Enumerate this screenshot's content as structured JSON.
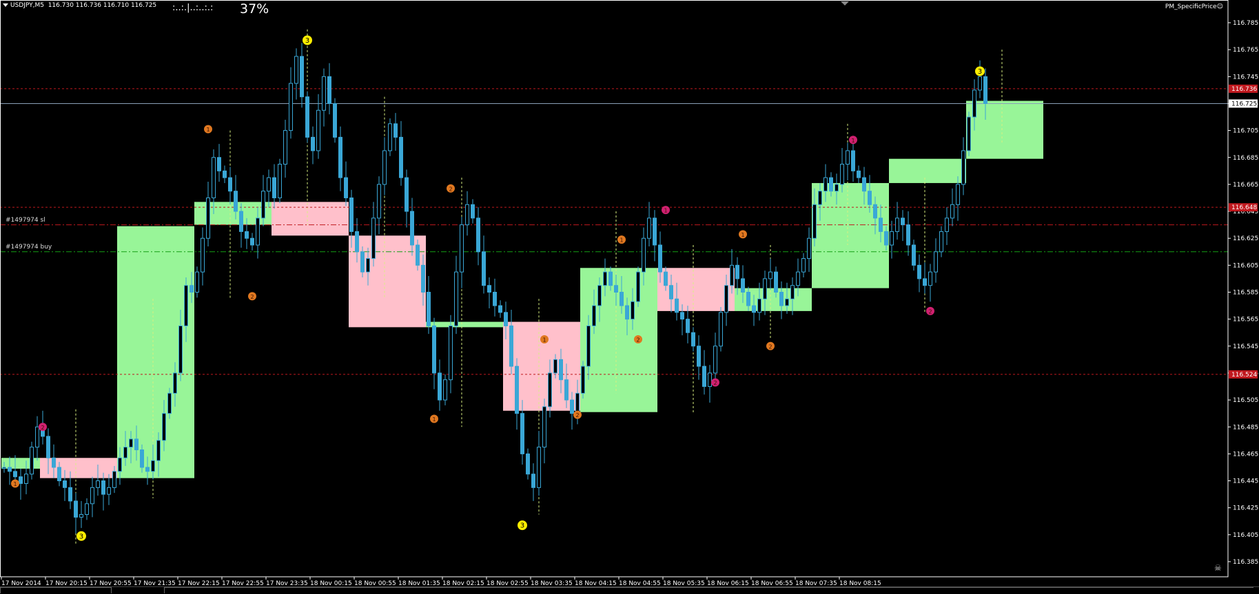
{
  "header": {
    "symbol": "USDJPY,M5",
    "ohlc": "116.730 116.736 116.710 116.725"
  },
  "progress": {
    "dots": ":..:.|..:..:.:",
    "percent_label": "37%",
    "percent_value": 37
  },
  "indicator_name": "PM_SpecificPrice",
  "orders": [
    {
      "label": "#1497974 sl",
      "price": 116.635,
      "color": "#c0181e"
    },
    {
      "label": "#1497974 buy",
      "price": 116.615,
      "color": "#14a014"
    }
  ],
  "price_axis": {
    "ticks": [
      "116.785",
      "116.765",
      "116.745",
      "116.725",
      "116.705",
      "116.685",
      "116.665",
      "116.645",
      "116.625",
      "116.605",
      "116.585",
      "116.565",
      "116.545",
      "116.525",
      "116.505",
      "116.485",
      "116.465",
      "116.445",
      "116.425",
      "116.405",
      "116.385"
    ],
    "current_price": "116.725",
    "marked_prices": [
      {
        "label": "116.736",
        "color": "#c0181e"
      },
      {
        "label": "116.648",
        "color": "#c0181e"
      },
      {
        "label": "116.524",
        "color": "#c0181e"
      }
    ]
  },
  "time_axis": {
    "labels": [
      "17 Nov 2014",
      "17 Nov 20:15",
      "17 Nov 20:55",
      "17 Nov 21:35",
      "17 Nov 22:15",
      "17 Nov 22:55",
      "17 Nov 23:35",
      "18 Nov 00:15",
      "18 Nov 00:55",
      "18 Nov 01:35",
      "18 Nov 02:15",
      "18 Nov 02:55",
      "18 Nov 03:35",
      "18 Nov 04:15",
      "18 Nov 04:55",
      "18 Nov 05:35",
      "18 Nov 06:15",
      "18 Nov 06:55",
      "18 Nov 07:35",
      "18 Nov 08:15"
    ]
  },
  "colors": {
    "background": "#000000",
    "candle": "#3aa7d6",
    "bull_box": "#98f598",
    "bear_box": "#ffc0cb",
    "grid_text": "#ffffff",
    "marker_yellow": "#ffee00",
    "marker_orange": "#e07820",
    "marker_pink": "#d02070"
  },
  "chart_data": {
    "type": "candlestick",
    "symbol": "USDJPY,M5",
    "ylim": [
      116.385,
      116.795
    ],
    "boxes": [
      {
        "type": "bull",
        "x0": 0,
        "x1": 7,
        "top": 116.462,
        "bot": 116.454
      },
      {
        "type": "bear",
        "x0": 7,
        "x1": 21,
        "top": 116.462,
        "bot": 116.447
      },
      {
        "type": "bull",
        "x0": 21,
        "x1": 35,
        "top": 116.634,
        "bot": 116.447
      },
      {
        "type": "bull",
        "x0": 35,
        "x1": 49,
        "top": 116.652,
        "bot": 116.635
      },
      {
        "type": "bear",
        "x0": 49,
        "x1": 63,
        "top": 116.652,
        "bot": 116.627
      },
      {
        "type": "bear",
        "x0": 63,
        "x1": 77,
        "top": 116.627,
        "bot": 116.559
      },
      {
        "type": "bull",
        "x0": 77,
        "x1": 91,
        "top": 116.563,
        "bot": 116.559
      },
      {
        "type": "bear",
        "x0": 91,
        "x1": 105,
        "top": 116.563,
        "bot": 116.497
      },
      {
        "type": "bull",
        "x0": 105,
        "x1": 119,
        "top": 116.603,
        "bot": 116.496
      },
      {
        "type": "bear",
        "x0": 119,
        "x1": 133,
        "top": 116.603,
        "bot": 116.571
      },
      {
        "type": "bull",
        "x0": 133,
        "x1": 147,
        "top": 116.588,
        "bot": 116.571
      },
      {
        "type": "bull",
        "x0": 147,
        "x1": 161,
        "top": 116.666,
        "bot": 116.588
      },
      {
        "type": "bull",
        "x0": 161,
        "x1": 175,
        "top": 116.684,
        "bot": 116.666
      },
      {
        "type": "bull",
        "x0": 175,
        "x1": 189,
        "top": 116.727,
        "bot": 116.684
      }
    ],
    "markers": [
      {
        "x": 2,
        "price": 116.443,
        "kind": "orange",
        "label": "1"
      },
      {
        "x": 7,
        "price": 116.485,
        "kind": "pink",
        "label": "2"
      },
      {
        "x": 14,
        "price": 116.404,
        "kind": "yellow",
        "label": "3"
      },
      {
        "x": 37,
        "price": 116.706,
        "kind": "orange",
        "label": "1"
      },
      {
        "x": 45,
        "price": 116.582,
        "kind": "orange",
        "label": "2"
      },
      {
        "x": 55,
        "price": 116.772,
        "kind": "yellow",
        "label": "3"
      },
      {
        "x": 78,
        "price": 116.491,
        "kind": "orange",
        "label": "1"
      },
      {
        "x": 81,
        "price": 116.662,
        "kind": "orange",
        "label": "2"
      },
      {
        "x": 94,
        "price": 116.412,
        "kind": "yellow",
        "label": "3"
      },
      {
        "x": 98,
        "price": 116.55,
        "kind": "orange",
        "label": "1"
      },
      {
        "x": 104,
        "price": 116.494,
        "kind": "orange",
        "label": "2"
      },
      {
        "x": 112,
        "price": 116.624,
        "kind": "orange",
        "label": "1"
      },
      {
        "x": 115,
        "price": 116.55,
        "kind": "orange",
        "label": "2"
      },
      {
        "x": 120,
        "price": 116.646,
        "kind": "pink",
        "label": "1"
      },
      {
        "x": 129,
        "price": 116.518,
        "kind": "pink",
        "label": "2"
      },
      {
        "x": 134,
        "price": 116.628,
        "kind": "orange",
        "label": "1"
      },
      {
        "x": 139,
        "price": 116.545,
        "kind": "orange",
        "label": "2"
      },
      {
        "x": 154,
        "price": 116.698,
        "kind": "pink",
        "label": "1"
      },
      {
        "x": 168,
        "price": 116.571,
        "kind": "pink",
        "label": "2"
      },
      {
        "x": 177,
        "price": 116.749,
        "kind": "yellow",
        "label": "3"
      }
    ],
    "vlines": [
      13,
      27,
      41,
      55,
      69,
      83,
      97,
      111,
      125,
      139,
      153,
      167,
      181
    ],
    "path": [
      116.455,
      116.452,
      116.448,
      116.443,
      116.45,
      116.47,
      116.485,
      116.478,
      116.462,
      116.455,
      116.445,
      116.44,
      116.43,
      116.418,
      116.42,
      116.428,
      116.44,
      116.445,
      116.435,
      116.44,
      116.452,
      116.462,
      116.47,
      116.476,
      116.468,
      116.455,
      116.452,
      116.46,
      116.475,
      116.495,
      116.51,
      116.525,
      116.56,
      116.59,
      116.585,
      116.6,
      116.625,
      116.655,
      116.685,
      116.675,
      116.67,
      116.66,
      116.645,
      116.63,
      116.625,
      116.62,
      116.64,
      116.66,
      116.67,
      116.655,
      116.68,
      116.705,
      116.74,
      116.76,
      116.73,
      116.7,
      116.69,
      116.72,
      116.745,
      116.725,
      116.7,
      116.67,
      116.655,
      116.63,
      116.615,
      116.6,
      116.61,
      116.64,
      116.665,
      116.69,
      116.71,
      116.7,
      116.67,
      116.645,
      116.62,
      116.605,
      116.585,
      116.56,
      116.525,
      116.505,
      116.52,
      116.56,
      116.6,
      116.635,
      116.65,
      116.64,
      116.615,
      116.59,
      116.585,
      116.575,
      116.57,
      116.56,
      116.53,
      116.495,
      116.465,
      116.45,
      116.44,
      116.47,
      116.5,
      116.525,
      116.535,
      116.52,
      116.505,
      116.495,
      116.51,
      116.53,
      116.56,
      116.575,
      116.59,
      116.6,
      116.59,
      116.585,
      116.575,
      116.565,
      116.578,
      116.6,
      116.625,
      116.64,
      116.62,
      116.6,
      116.59,
      116.58,
      116.57,
      116.565,
      116.555,
      116.545,
      116.53,
      116.515,
      116.525,
      116.545,
      116.57,
      116.59,
      116.605,
      116.595,
      116.585,
      116.575,
      116.57,
      116.58,
      116.595,
      116.6,
      116.585,
      116.575,
      116.58,
      116.59,
      116.6,
      116.61,
      116.625,
      116.65,
      116.66,
      116.67,
      116.66,
      116.665,
      116.68,
      116.69,
      116.675,
      116.67,
      116.66,
      116.65,
      116.64,
      116.63,
      116.62,
      116.63,
      116.64,
      116.635,
      116.62,
      116.605,
      116.595,
      116.59,
      116.6,
      116.615,
      116.63,
      116.64,
      116.65,
      116.665,
      116.69,
      116.715,
      116.735,
      116.745,
      116.725
    ]
  }
}
